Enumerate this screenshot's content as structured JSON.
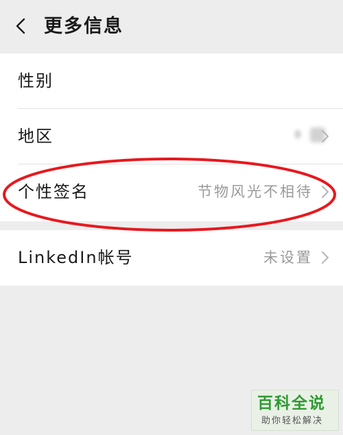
{
  "header": {
    "title": "更多信息",
    "back_icon": "chevron-left-icon"
  },
  "rows": [
    {
      "label": "性别",
      "value": ""
    },
    {
      "label": "地区",
      "value": ""
    },
    {
      "label": "个性签名",
      "value": "节物风光不相待"
    },
    {
      "label": "LinkedIn帐号",
      "value": "未设置"
    }
  ],
  "annotation": {
    "color": "#e8181e"
  },
  "watermark": {
    "brand": "百科全说",
    "tagline": "助你轻松解决",
    "color": "#2f9a32"
  }
}
